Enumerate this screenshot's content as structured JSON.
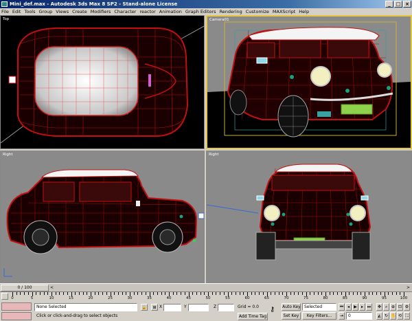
{
  "window": {
    "title": "Mini_def.max - Autodesk 3ds Max 8 SP2 - Stand-alone License",
    "min_glyph": "_",
    "max_glyph": "□",
    "close_glyph": "×"
  },
  "menu": [
    "File",
    "Edit",
    "Tools",
    "Group",
    "Views",
    "Create",
    "Modifiers",
    "Character",
    "reactor",
    "Animation",
    "Graph Editors",
    "Rendering",
    "Customize",
    "MAXScript",
    "Help"
  ],
  "viewports": {
    "top": {
      "label": "Top"
    },
    "camera": {
      "label": "Camera01"
    },
    "right": {
      "label": "Right"
    },
    "front": {
      "label": "Right"
    }
  },
  "time_slider": {
    "thumb_label": "0 / 100",
    "left_arrow": "<",
    "right_arrow": ">"
  },
  "ruler": {
    "labels": [
      "0",
      "5",
      "10",
      "15",
      "20",
      "25",
      "30",
      "35",
      "40",
      "45",
      "50",
      "55",
      "60",
      "65",
      "70",
      "75",
      "80",
      "85",
      "90",
      "95",
      "100"
    ]
  },
  "status": {
    "selection": "None Selected",
    "prompt": "Click or click-and-drag to select objects",
    "x_label": "X",
    "y_label": "Y",
    "z_label": "Z",
    "x_value": "",
    "y_value": "",
    "z_value": "",
    "grid": "Grid = 0.0",
    "add_time_tag": "Add Time Tag",
    "auto_key": "Auto Key",
    "auto_key_value": "Selected",
    "set_key": "Set Key",
    "key_filters": "Key Filters...",
    "frame_value": "0"
  },
  "colors": {
    "accent_active_viewport": "#e5c840",
    "wire": "#c21010",
    "plate": "#8fd14a",
    "title_bar": "#0a246a"
  }
}
